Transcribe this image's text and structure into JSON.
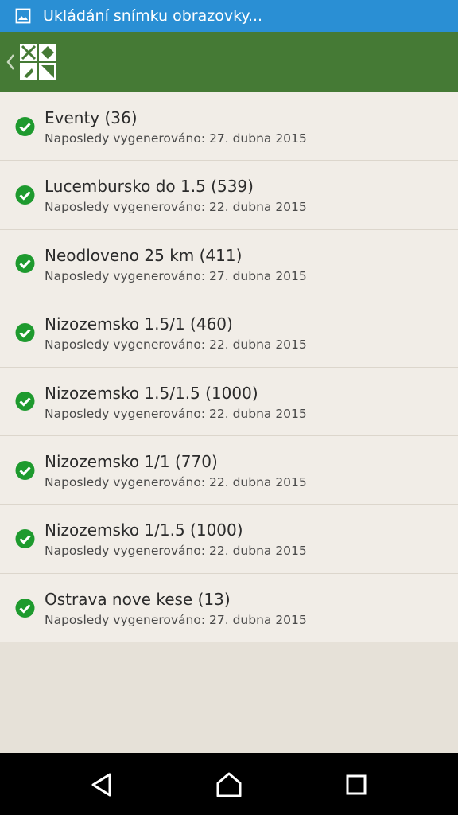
{
  "status_bar": {
    "text": "Ukládání snímku obrazovky...",
    "icon": "image-icon",
    "background": "#2a8fd4"
  },
  "action_bar": {
    "background": "#457a35",
    "back_icon": "chevron-left-icon",
    "logo": "geocaching-logo"
  },
  "list": {
    "items": [
      {
        "title": "Eventy (36)",
        "subtitle": "Naposledy vygenerováno: 27. dubna 2015",
        "icon": "check-circle-icon"
      },
      {
        "title": "Lucembursko do 1.5 (539)",
        "subtitle": "Naposledy vygenerováno: 22. dubna 2015",
        "icon": "check-circle-icon"
      },
      {
        "title": "Neodloveno 25 km (411)",
        "subtitle": "Naposledy vygenerováno: 27. dubna 2015",
        "icon": "check-circle-icon"
      },
      {
        "title": "Nizozemsko 1.5/1 (460)",
        "subtitle": "Naposledy vygenerováno: 22. dubna 2015",
        "icon": "check-circle-icon"
      },
      {
        "title": "Nizozemsko 1.5/1.5 (1000)",
        "subtitle": "Naposledy vygenerováno: 22. dubna 2015",
        "icon": "check-circle-icon"
      },
      {
        "title": "Nizozemsko 1/1 (770)",
        "subtitle": "Naposledy vygenerováno: 22. dubna 2015",
        "icon": "check-circle-icon"
      },
      {
        "title": "Nizozemsko 1/1.5 (1000)",
        "subtitle": "Naposledy vygenerováno: 22. dubna 2015",
        "icon": "check-circle-icon"
      },
      {
        "title": "Ostrava nove kese (13)",
        "subtitle": "Naposledy vygenerováno: 27. dubna 2015",
        "icon": "check-circle-icon"
      }
    ],
    "check_color": "#1e9a2e"
  },
  "nav_bar": {
    "back_icon": "back-triangle-icon",
    "home_icon": "home-icon",
    "recents_icon": "recents-square-icon"
  }
}
